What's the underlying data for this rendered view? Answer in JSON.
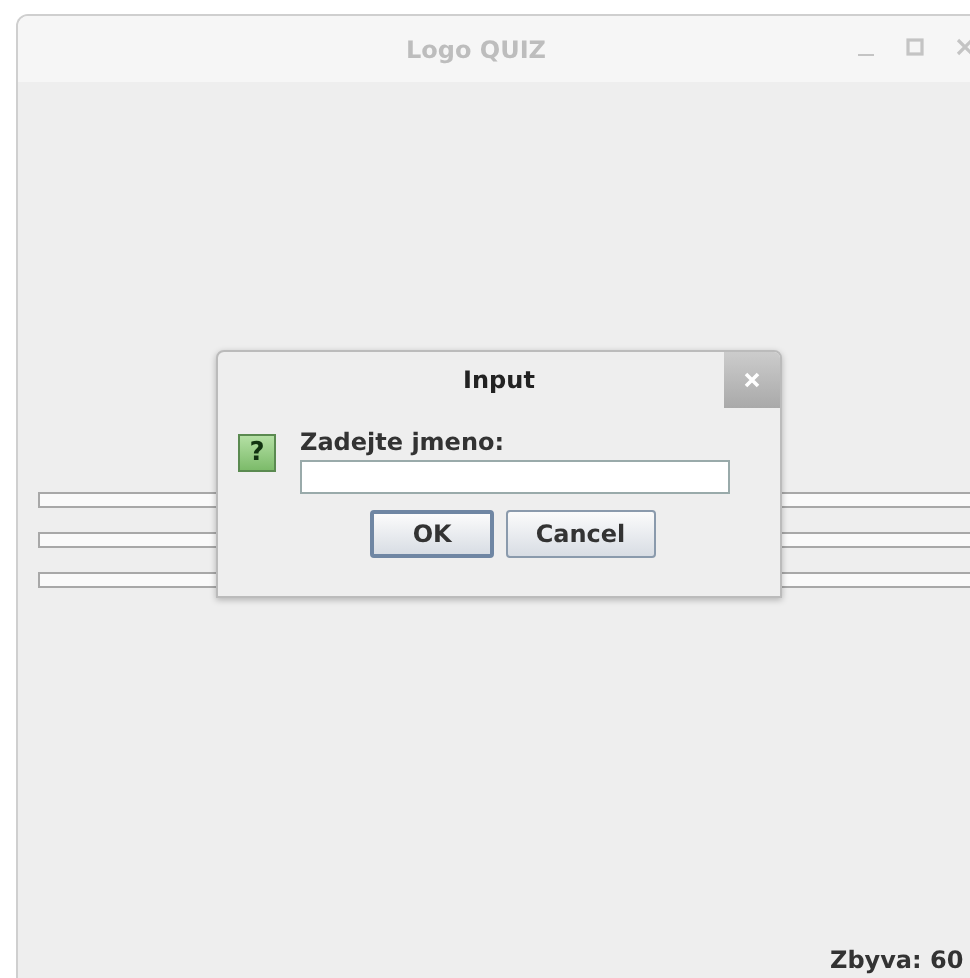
{
  "window": {
    "title": "Logo QUIZ"
  },
  "dialog": {
    "title": "Input",
    "icon": "?",
    "prompt": "Zadejte jmeno:",
    "buttons": [
      {
        "label": "OK",
        "selected": true
      },
      {
        "label": "Cancel",
        "selected": false
      }
    ]
  },
  "status": "Zbyva: 60"
}
